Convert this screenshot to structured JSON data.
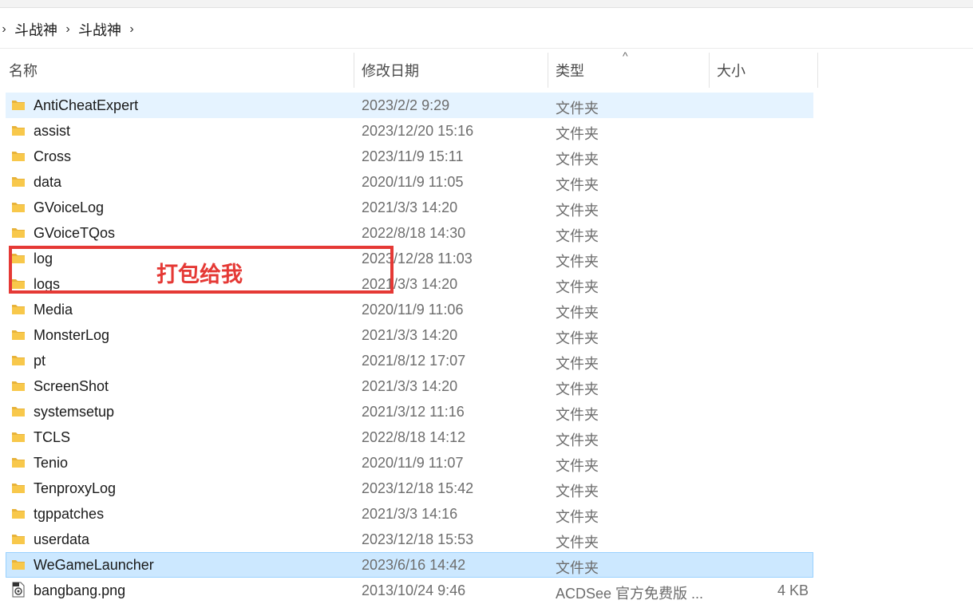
{
  "breadcrumb": {
    "items": [
      "斗战神",
      "斗战神"
    ]
  },
  "columns": {
    "name": "名称",
    "date": "修改日期",
    "type": "类型",
    "size": "大小"
  },
  "rows": [
    {
      "name": "AntiCheatExpert",
      "date": "2023/2/2 9:29",
      "type": "文件夹",
      "size": "",
      "icon": "folder-icon"
    },
    {
      "name": "assist",
      "date": "2023/12/20 15:16",
      "type": "文件夹",
      "size": "",
      "icon": "folder-icon"
    },
    {
      "name": "Cross",
      "date": "2023/11/9 15:11",
      "type": "文件夹",
      "size": "",
      "icon": "folder-icon"
    },
    {
      "name": "data",
      "date": "2020/11/9 11:05",
      "type": "文件夹",
      "size": "",
      "icon": "folder-icon"
    },
    {
      "name": "GVoiceLog",
      "date": "2021/3/3 14:20",
      "type": "文件夹",
      "size": "",
      "icon": "folder-icon"
    },
    {
      "name": "GVoiceTQos",
      "date": "2022/8/18 14:30",
      "type": "文件夹",
      "size": "",
      "icon": "folder-icon"
    },
    {
      "name": "log",
      "date": "2023/12/28 11:03",
      "type": "文件夹",
      "size": "",
      "icon": "folder-icon"
    },
    {
      "name": "logs",
      "date": "2021/3/3 14:20",
      "type": "文件夹",
      "size": "",
      "icon": "folder-icon"
    },
    {
      "name": "Media",
      "date": "2020/11/9 11:06",
      "type": "文件夹",
      "size": "",
      "icon": "folder-icon"
    },
    {
      "name": "MonsterLog",
      "date": "2021/3/3 14:20",
      "type": "文件夹",
      "size": "",
      "icon": "folder-icon"
    },
    {
      "name": "pt",
      "date": "2021/8/12 17:07",
      "type": "文件夹",
      "size": "",
      "icon": "folder-icon"
    },
    {
      "name": "ScreenShot",
      "date": "2021/3/3 14:20",
      "type": "文件夹",
      "size": "",
      "icon": "folder-icon"
    },
    {
      "name": "systemsetup",
      "date": "2021/3/12 11:16",
      "type": "文件夹",
      "size": "",
      "icon": "folder-icon"
    },
    {
      "name": "TCLS",
      "date": "2022/8/18 14:12",
      "type": "文件夹",
      "size": "",
      "icon": "folder-icon"
    },
    {
      "name": "Tenio",
      "date": "2020/11/9 11:07",
      "type": "文件夹",
      "size": "",
      "icon": "folder-icon"
    },
    {
      "name": "TenproxyLog",
      "date": "2023/12/18 15:42",
      "type": "文件夹",
      "size": "",
      "icon": "folder-icon"
    },
    {
      "name": "tgppatches",
      "date": "2021/3/3 14:16",
      "type": "文件夹",
      "size": "",
      "icon": "folder-icon"
    },
    {
      "name": "userdata",
      "date": "2023/12/18 15:53",
      "type": "文件夹",
      "size": "",
      "icon": "folder-icon"
    },
    {
      "name": "WeGameLauncher",
      "date": "2023/6/16 14:42",
      "type": "文件夹",
      "size": "",
      "icon": "folder-icon"
    },
    {
      "name": "bangbang.png",
      "date": "2013/10/24 9:46",
      "type": "ACDSee 官方免费版 ...",
      "size": "4 KB",
      "icon": "png-file-icon"
    }
  ],
  "annotation": {
    "text": "打包给我",
    "color": "#e53935"
  },
  "colors": {
    "selection": "#cce8ff",
    "hover": "#e5f3ff",
    "folder": "#f8c84b"
  }
}
